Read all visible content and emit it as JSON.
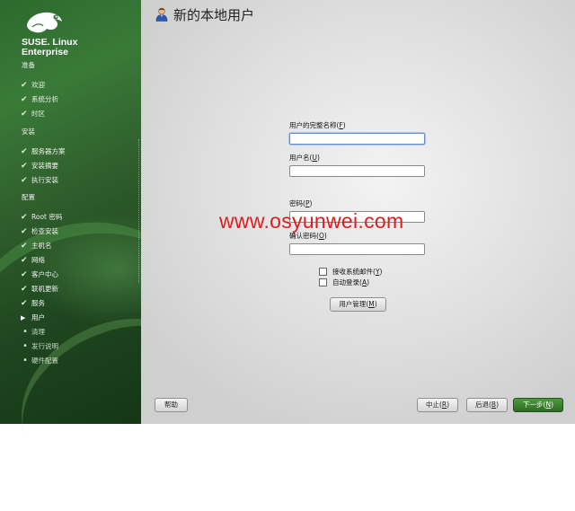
{
  "sidebar": {
    "brand_line1": "SUSE. Linux",
    "brand_line2": "Enterprise",
    "sections": [
      {
        "title": "准备",
        "steps": [
          {
            "label": "欢迎",
            "state": "done"
          },
          {
            "label": "系统分析",
            "state": "done"
          },
          {
            "label": "时区",
            "state": "done"
          }
        ]
      },
      {
        "title": "安装",
        "steps": [
          {
            "label": "服务器方案",
            "state": "done"
          },
          {
            "label": "安装摘要",
            "state": "done"
          },
          {
            "label": "执行安装",
            "state": "done"
          }
        ]
      },
      {
        "title": "配置",
        "steps": [
          {
            "label": "Root 密码",
            "state": "done"
          },
          {
            "label": "检查安装",
            "state": "done"
          },
          {
            "label": "主机名",
            "state": "done"
          },
          {
            "label": "网络",
            "state": "done"
          },
          {
            "label": "客户中心",
            "state": "done"
          },
          {
            "label": "联机更新",
            "state": "done"
          },
          {
            "label": "服务",
            "state": "done"
          },
          {
            "label": "用户",
            "state": "current"
          },
          {
            "label": "清理",
            "state": "pending"
          },
          {
            "label": "发行说明",
            "state": "pending"
          },
          {
            "label": "硬件配置",
            "state": "pending"
          }
        ]
      }
    ]
  },
  "main": {
    "title": "新的本地用户",
    "fullname_label": "用户的完整名称",
    "fullname_mnemonic": "F",
    "fullname_value": "",
    "username_label": "用户名",
    "username_mnemonic": "U",
    "username_value": "",
    "password_label": "密码",
    "password_mnemonic": "P",
    "password_value": "",
    "confirm_label": "确认密码",
    "confirm_mnemonic": "O",
    "confirm_value": "",
    "receive_mail_label": "接收系统邮件",
    "receive_mail_mnemonic": "Y",
    "receive_mail_checked": false,
    "autologin_label": "自动登录",
    "autologin_mnemonic": "A",
    "autologin_checked": false,
    "user_mgmt_label": "用户管理",
    "user_mgmt_mnemonic": "M"
  },
  "footer": {
    "help": "帮助",
    "abort": "中止",
    "abort_mnemonic": "R",
    "back": "后退",
    "back_mnemonic": "B",
    "next": "下一步",
    "next_mnemonic": "N"
  },
  "watermark": "www.osyunwei.com",
  "colors": {
    "sidebar_green": "#2f5f2c",
    "primary_button": "#3f8a32",
    "watermark_red": "#e21c1c"
  }
}
